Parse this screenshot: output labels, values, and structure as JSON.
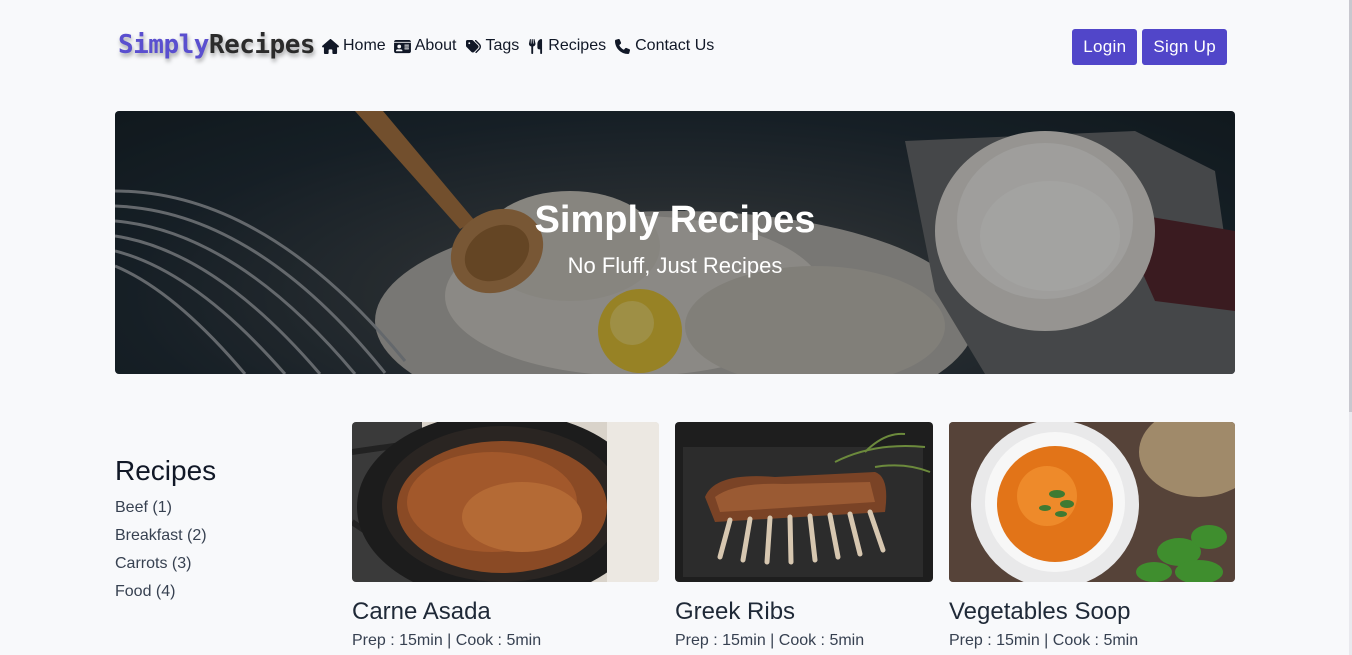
{
  "brand": {
    "part1": "Simply",
    "part2": "Recipes"
  },
  "nav": {
    "items": [
      {
        "label": "Home",
        "icon": "home-icon"
      },
      {
        "label": "About",
        "icon": "id-card-icon"
      },
      {
        "label": "Tags",
        "icon": "tags-icon"
      },
      {
        "label": "Recipes",
        "icon": "utensils-icon"
      },
      {
        "label": "Contact Us",
        "icon": "phone-icon"
      }
    ],
    "login": "Login",
    "signup": "Sign Up"
  },
  "hero": {
    "title": "Simply Recipes",
    "subtitle": "No Fluff, Just Recipes"
  },
  "sidebar": {
    "title": "Recipes",
    "tags": [
      {
        "label": "Beef (1)"
      },
      {
        "label": "Breakfast (2)"
      },
      {
        "label": "Carrots (3)"
      },
      {
        "label": "Food (4)"
      }
    ]
  },
  "recipes": [
    {
      "title": "Carne Asada",
      "meta": "Prep : 15min | Cook : 5min"
    },
    {
      "title": "Greek Ribs",
      "meta": "Prep : 15min | Cook : 5min"
    },
    {
      "title": "Vegetables Soop",
      "meta": "Prep : 15min | Cook : 5min"
    }
  ],
  "colors": {
    "accent": "#5146c9",
    "brand": "#5a4fcf",
    "background": "#f8f9fb"
  }
}
